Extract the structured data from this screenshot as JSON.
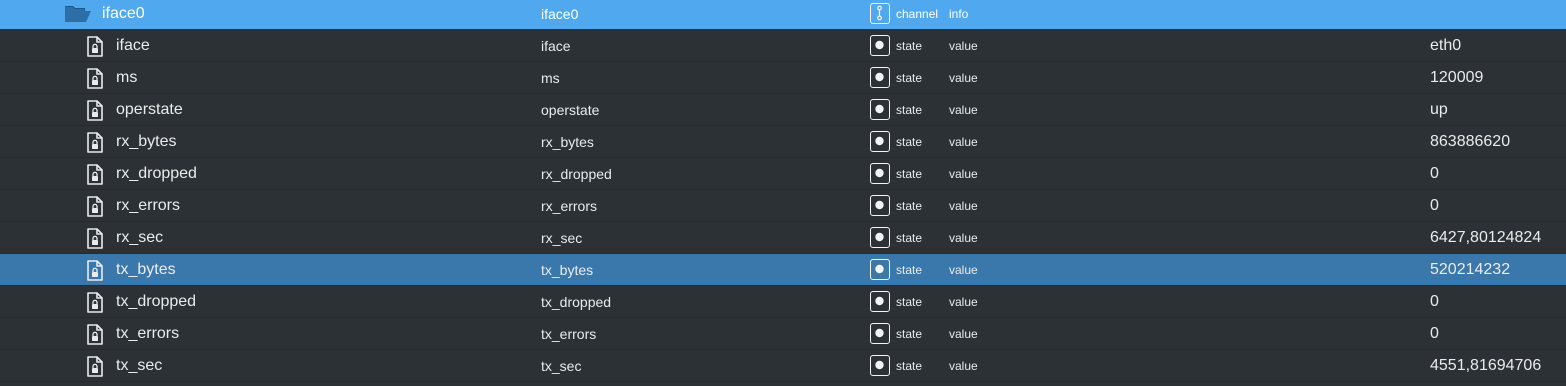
{
  "channel": {
    "name": "iface0",
    "id": "iface0",
    "type": "channel",
    "role": "info",
    "icon": "folder-open-icon"
  },
  "states": [
    {
      "name": "iface",
      "id": "iface",
      "type": "state",
      "role": "value",
      "value": "eth0",
      "selected": false
    },
    {
      "name": "ms",
      "id": "ms",
      "type": "state",
      "role": "value",
      "value": "120009",
      "selected": false
    },
    {
      "name": "operstate",
      "id": "operstate",
      "type": "state",
      "role": "value",
      "value": "up",
      "selected": false
    },
    {
      "name": "rx_bytes",
      "id": "rx_bytes",
      "type": "state",
      "role": "value",
      "value": "863886620",
      "selected": false
    },
    {
      "name": "rx_dropped",
      "id": "rx_dropped",
      "type": "state",
      "role": "value",
      "value": "0",
      "selected": false
    },
    {
      "name": "rx_errors",
      "id": "rx_errors",
      "type": "state",
      "role": "value",
      "value": "0",
      "selected": false
    },
    {
      "name": "rx_sec",
      "id": "rx_sec",
      "type": "state",
      "role": "value",
      "value": "6427,80124824",
      "selected": false
    },
    {
      "name": "tx_bytes",
      "id": "tx_bytes",
      "type": "state",
      "role": "value",
      "value": "520214232",
      "selected": true
    },
    {
      "name": "tx_dropped",
      "id": "tx_dropped",
      "type": "state",
      "role": "value",
      "value": "0",
      "selected": false
    },
    {
      "name": "tx_errors",
      "id": "tx_errors",
      "type": "state",
      "role": "value",
      "value": "0",
      "selected": false
    },
    {
      "name": "tx_sec",
      "id": "tx_sec",
      "type": "state",
      "role": "value",
      "value": "4551,81694706",
      "selected": false
    }
  ],
  "colors": {
    "background": "#2b3135",
    "channel_row": "#50a9ee",
    "selected_row": "#3a77aa",
    "text": "#e9ecee"
  }
}
